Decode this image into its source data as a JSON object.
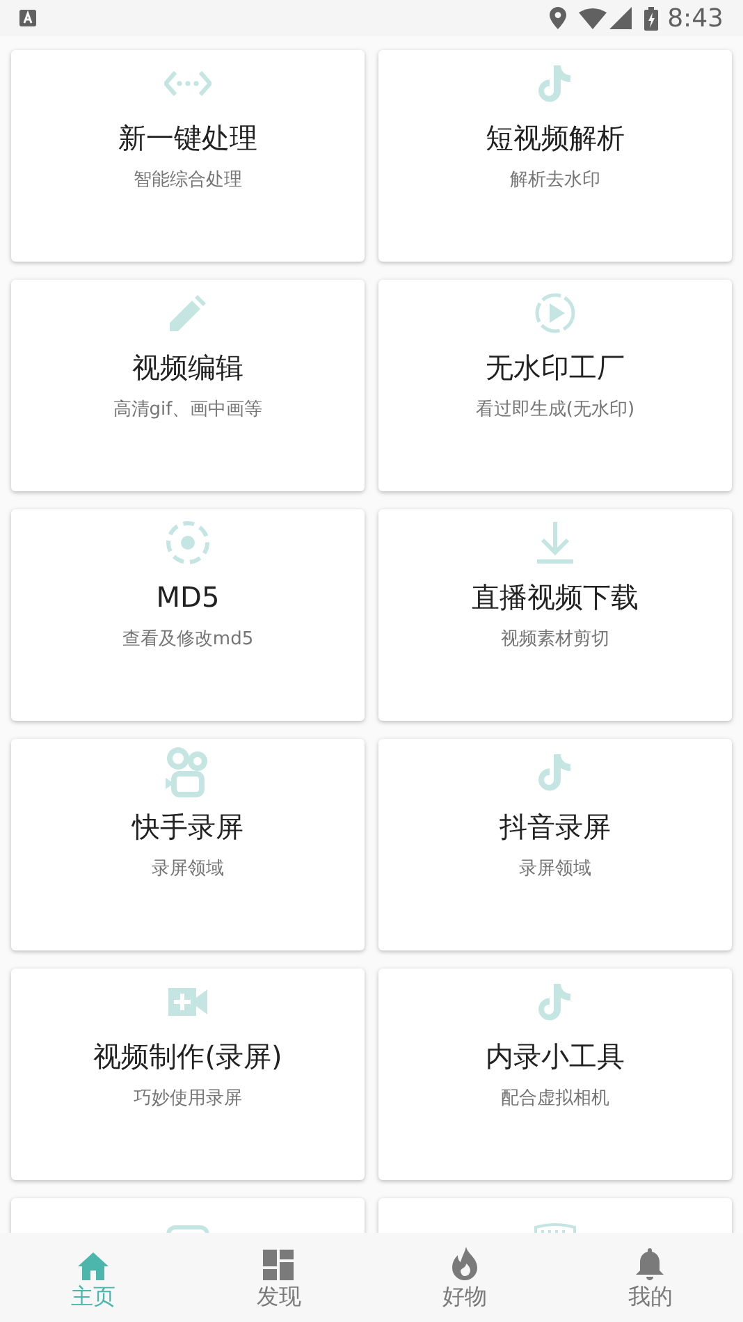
{
  "status_bar": {
    "time": "8:43"
  },
  "cards": [
    {
      "title": "新一键处理",
      "subtitle": "智能综合处理"
    },
    {
      "title": "短视频解析",
      "subtitle": "解析去水印"
    },
    {
      "title": "视频编辑",
      "subtitle": "高清gif、画中画等"
    },
    {
      "title": "无水印工厂",
      "subtitle": "看过即生成(无水印)"
    },
    {
      "title": "MD5",
      "subtitle": "查看及修改md5"
    },
    {
      "title": "直播视频下载",
      "subtitle": "视频素材剪切"
    },
    {
      "title": "快手录屏",
      "subtitle": "录屏领域"
    },
    {
      "title": "抖音录屏",
      "subtitle": "录屏领域"
    },
    {
      "title": "视频制作(录屏)",
      "subtitle": "巧妙使用录屏"
    },
    {
      "title": "内录小工具",
      "subtitle": "配合虚拟相机"
    }
  ],
  "nav": [
    {
      "label": "主页",
      "selected": true
    },
    {
      "label": "发现",
      "selected": false
    },
    {
      "label": "好物",
      "selected": false
    },
    {
      "label": "我的",
      "selected": false
    }
  ]
}
